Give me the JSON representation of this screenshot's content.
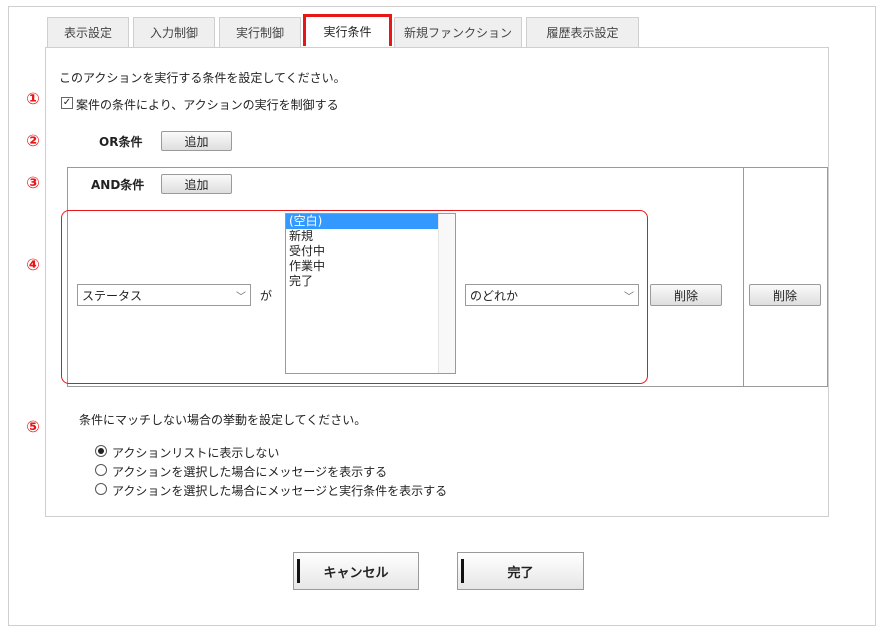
{
  "tabs": [
    "表示設定",
    "入力制御",
    "実行制御",
    "実行条件",
    "新規ファンクション",
    "履歴表示設定"
  ],
  "markers": [
    "①",
    "②",
    "③",
    "④",
    "⑤"
  ],
  "intro_text": "このアクションを実行する条件を設定してください。",
  "checkbox_label": "案件の条件により、アクションの実行を制御する",
  "checkbox_checked": true,
  "or_label": "OR条件",
  "and_label": "AND条件",
  "add_label": "追加",
  "field_select": "ステータス",
  "ga_text": "が",
  "list_options": [
    "(空白)",
    "新規",
    "受付中",
    "作業中",
    "完了"
  ],
  "list_selected": "(空白)",
  "match_select": "のどれか",
  "delete_label": "削除",
  "nomatch_text": "条件にマッチしない場合の挙動を設定してください。",
  "radio_options": [
    "アクションリストに表示しない",
    "アクションを選択した場合にメッセージを表示する",
    "アクションを選択した場合にメッセージと実行条件を表示する"
  ],
  "radio_selected": "アクションリストに表示しない",
  "cancel_label": "キャンセル",
  "done_label": "完了"
}
